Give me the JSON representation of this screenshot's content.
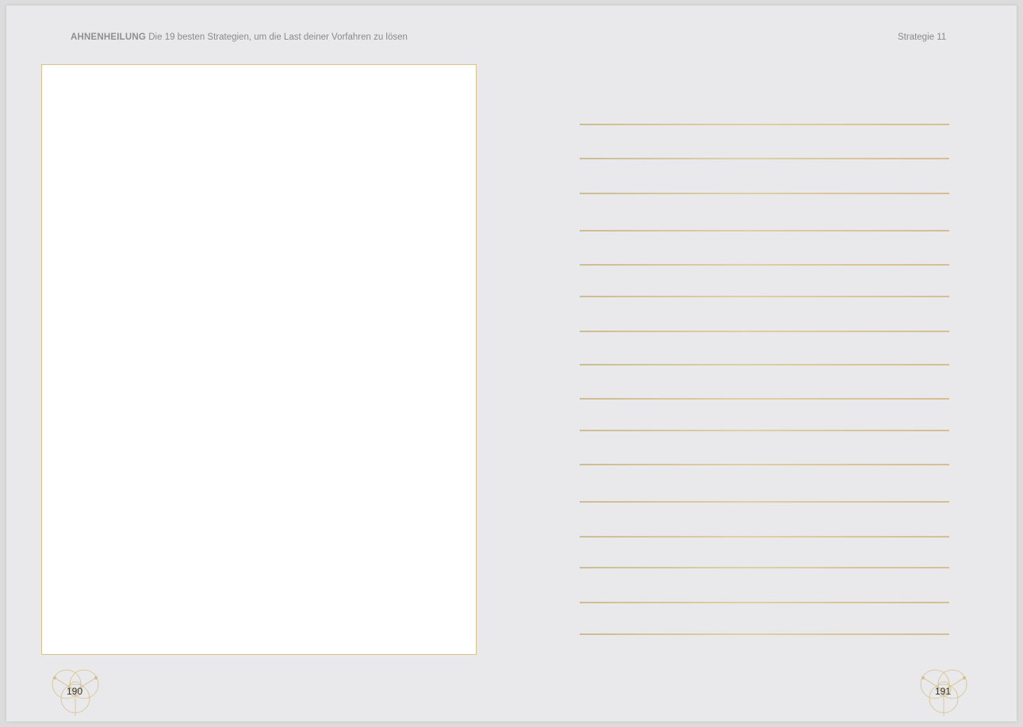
{
  "header": {
    "brand": "AHNENHEILUNG",
    "subtitle": "Die 19 besten Strategien, um die Last deiner Vorfahren zu lösen",
    "section": "Strategie 11"
  },
  "left_page": {
    "page_number": "190"
  },
  "right_page": {
    "page_number": "191",
    "writing_line_count": 16
  },
  "colors": {
    "page_background": "#e9e9eb",
    "gold_accent": "#d2bf93",
    "frame_border": "#d8c28e"
  },
  "icons": {
    "page_ornament": "circle-ornament-icon"
  }
}
